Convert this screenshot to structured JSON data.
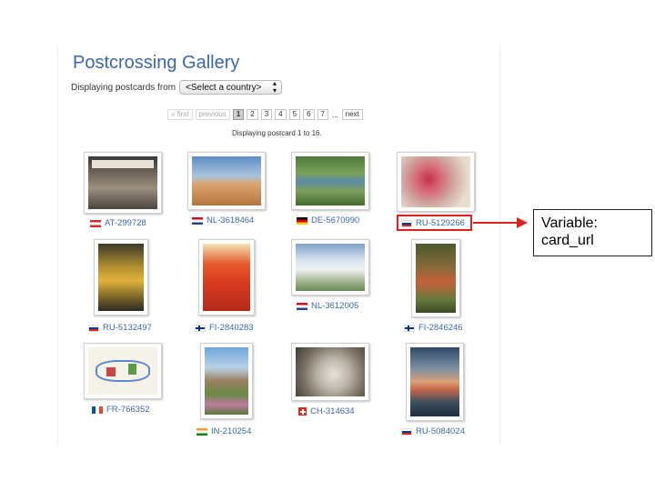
{
  "page": {
    "title": "Postcrossing Gallery",
    "filter_label": "Displaying postcards from",
    "country_select": "<Select a country>",
    "range_text": "Displaying postcard 1 to 16."
  },
  "pagination": {
    "first": "« first",
    "previous": "previous",
    "pages": [
      "1",
      "2",
      "3",
      "4",
      "5",
      "6",
      "7"
    ],
    "current": "1",
    "ellipsis": "...",
    "next": "next"
  },
  "postcards": [
    {
      "id": "AT-299728",
      "flag": "at"
    },
    {
      "id": "NL-3618464",
      "flag": "nl"
    },
    {
      "id": "DE-5670990",
      "flag": "de"
    },
    {
      "id": "RU-5129266",
      "flag": "ru"
    },
    {
      "id": "RU-5132497",
      "flag": "ru"
    },
    {
      "id": "FI-2840283",
      "flag": "fi"
    },
    {
      "id": "NL-3612005",
      "flag": "nl"
    },
    {
      "id": "FI-2846246",
      "flag": "fi"
    },
    {
      "id": "FR-766352",
      "flag": "fr"
    },
    {
      "id": "IN-210254",
      "flag": "in"
    },
    {
      "id": "CH-314634",
      "flag": "ch"
    },
    {
      "id": "RU-5084024",
      "flag": "ru"
    }
  ],
  "annotation": {
    "line1": "Variable:",
    "line2": "card_url",
    "color": "#e02020"
  },
  "colors": {
    "link": "#3d68a8",
    "title": "#3d68a8"
  }
}
